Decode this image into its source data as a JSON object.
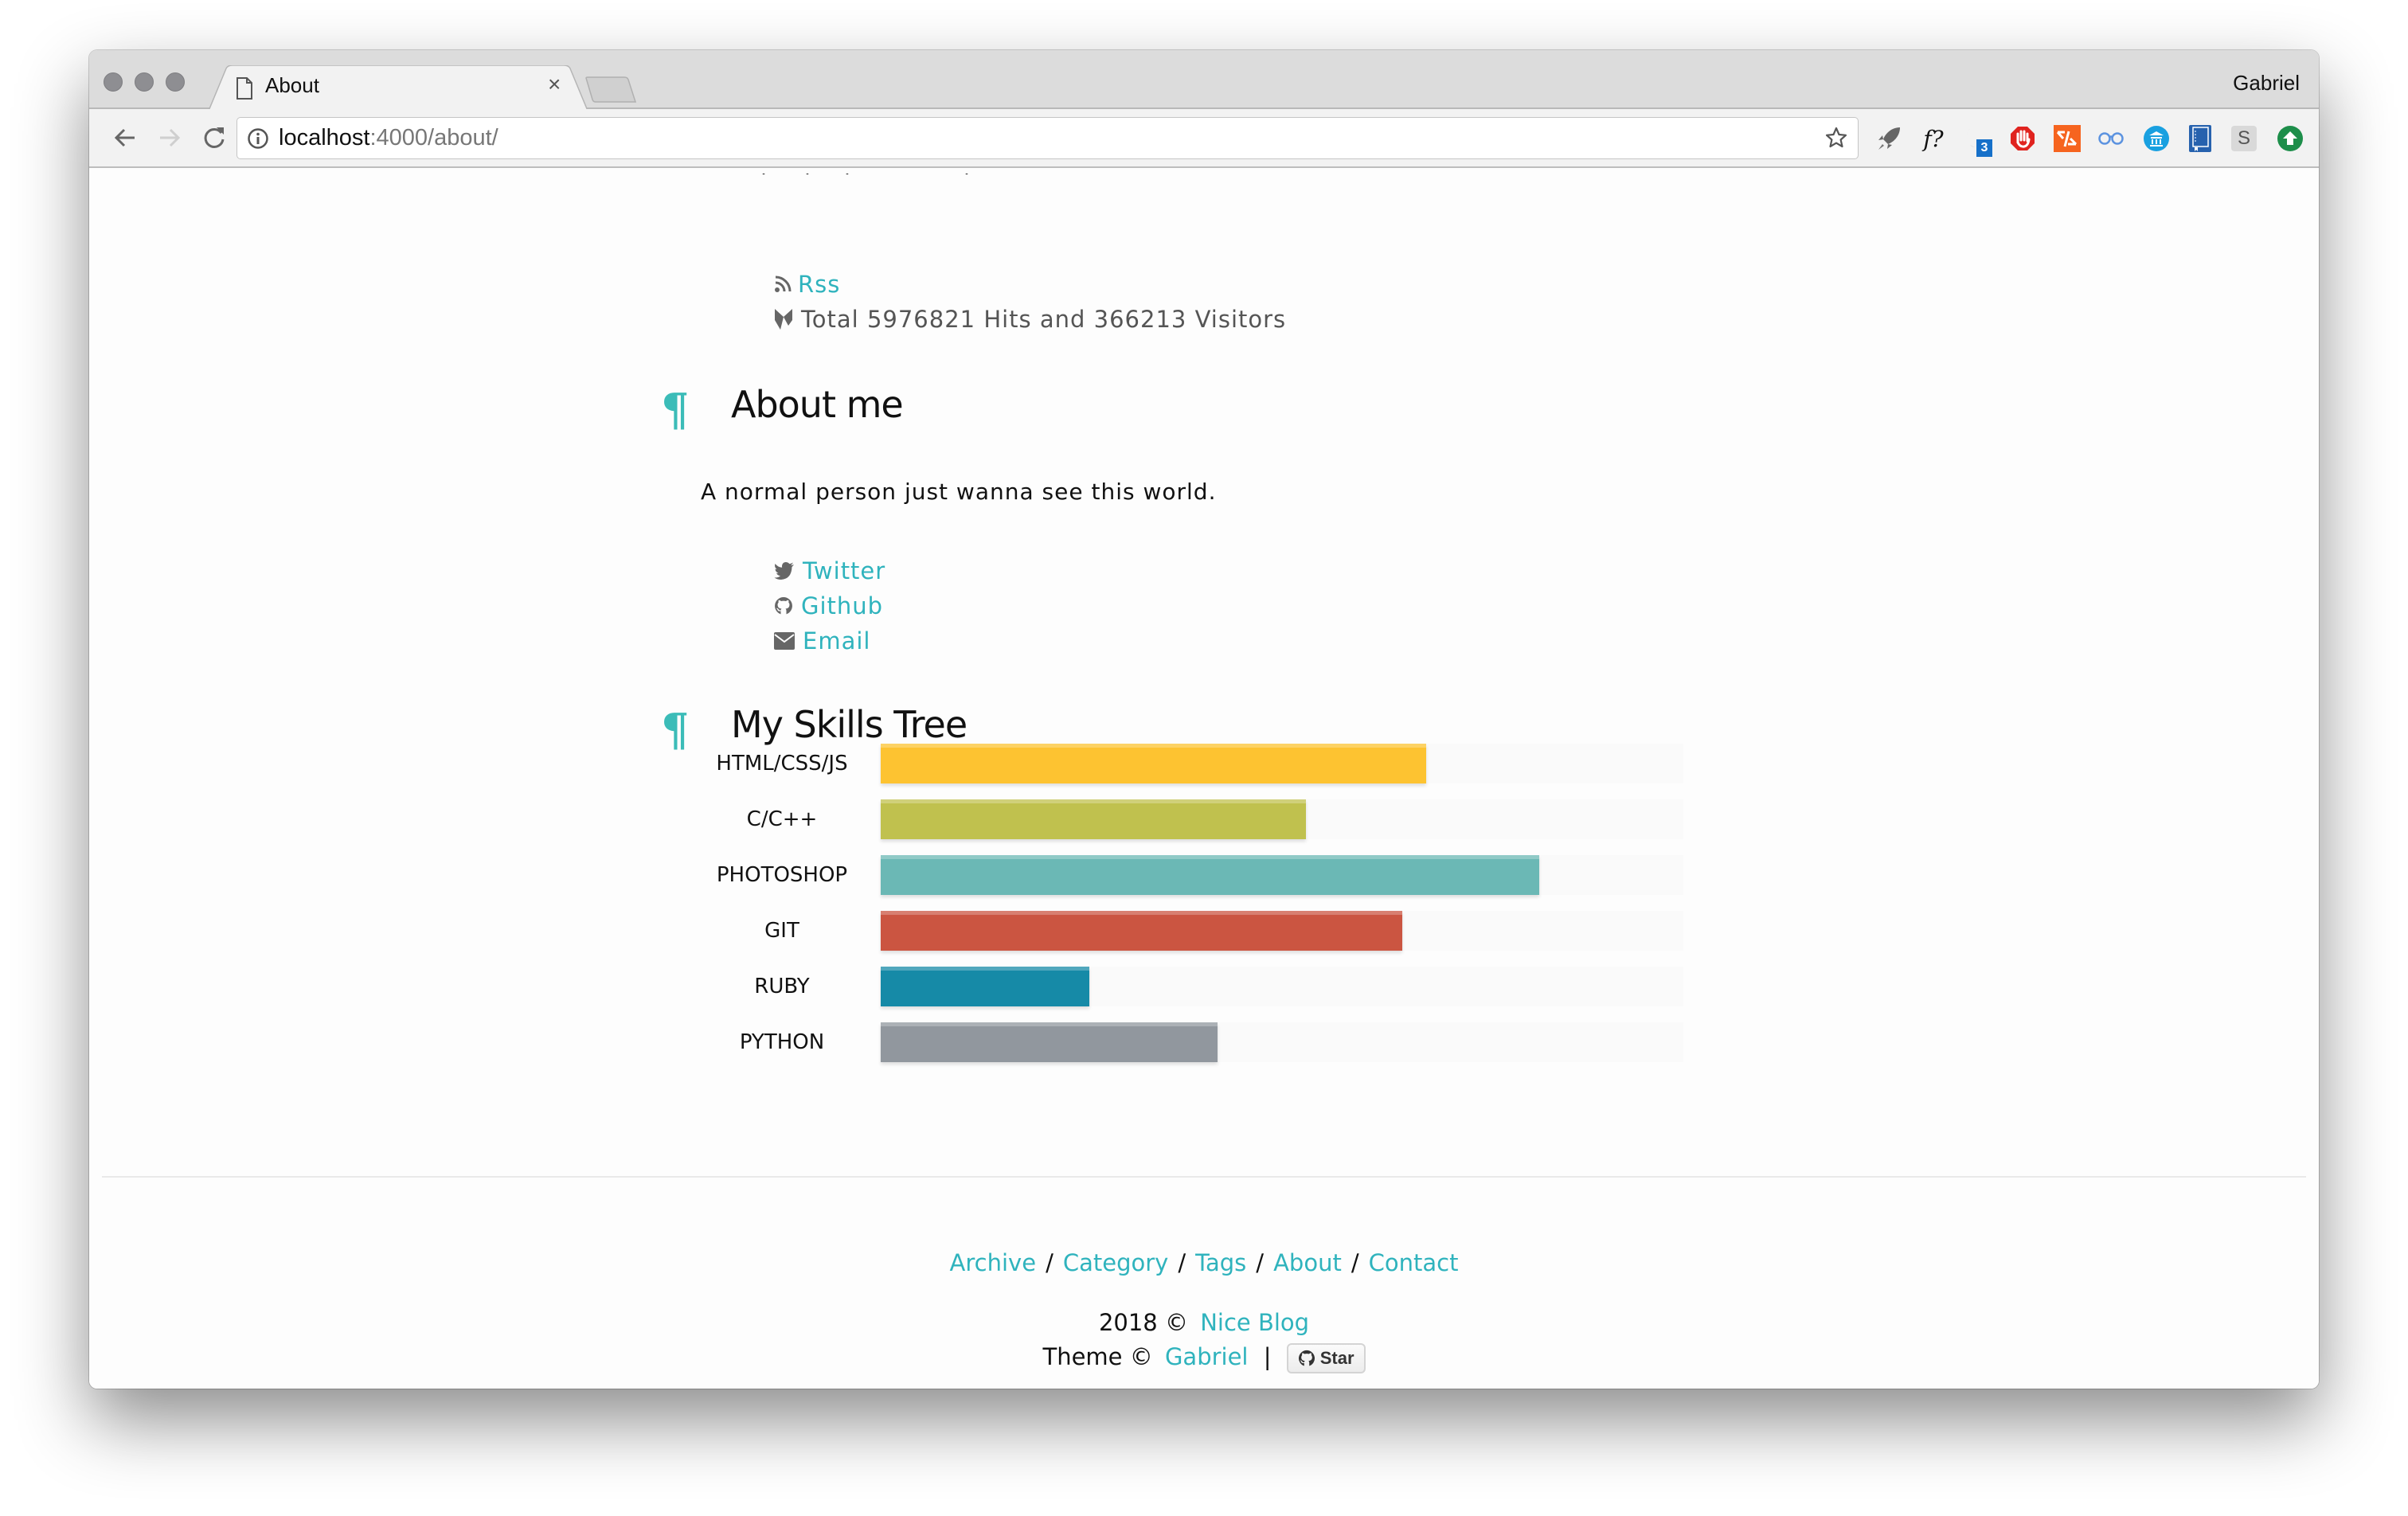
{
  "browser": {
    "tab_title": "About",
    "profile_name": "Gabriel",
    "url_host": "localhost",
    "url_rest": ":4000/about/",
    "extensions": [
      {
        "name": "rocket-extension-icon"
      },
      {
        "name": "formula-extension-icon",
        "label": "f?"
      },
      {
        "name": "moon-extension-icon",
        "badge": "3"
      },
      {
        "name": "adblock-extension-icon"
      },
      {
        "name": "code-extension-icon"
      },
      {
        "name": "glasses-extension-icon"
      },
      {
        "name": "bank-extension-icon"
      },
      {
        "name": "book-extension-icon"
      },
      {
        "name": "s-extension-icon",
        "label": "S"
      },
      {
        "name": "upload-extension-icon"
      }
    ]
  },
  "links_top": {
    "rss": "Rss",
    "stats": "Total 5976821 Hits and 366213 Visitors"
  },
  "about": {
    "heading": "About me",
    "pilcrow": "¶",
    "bio": "A normal person just wanna see this world.",
    "social": [
      {
        "label": "Twitter",
        "icon": "twitter-icon"
      },
      {
        "label": "Github",
        "icon": "github-icon"
      },
      {
        "label": "Email",
        "icon": "email-icon"
      }
    ]
  },
  "skills": {
    "heading": "My Skills Tree",
    "pilcrow": "¶"
  },
  "chart_data": {
    "type": "bar",
    "orientation": "horizontal",
    "title": "My Skills Tree",
    "categories": [
      "HTML/CSS/JS",
      "C/C++",
      "PHOTOSHOP",
      "GIT",
      "RUBY",
      "PYTHON"
    ],
    "values": [
      68,
      53,
      82,
      65,
      26,
      42
    ],
    "colors": [
      "#fdc331",
      "#c0c14e",
      "#6bb8b5",
      "#cb5541",
      "#168aa7",
      "#91979e"
    ],
    "xlim": [
      0,
      100
    ],
    "unit": "%",
    "grid": false,
    "legend": "none"
  },
  "footer": {
    "nav": [
      "Archive",
      "Category",
      "Tags",
      "About",
      "Contact"
    ],
    "separator": "/",
    "copyright_prefix": "2018 ©",
    "site_name": "Nice Blog",
    "theme_prefix": "Theme ©",
    "theme_author": "Gabriel",
    "pipe": "|",
    "star_label": "Star"
  },
  "colors": {
    "accent": "#2fb3bd",
    "pilcrow": "#3bbcb8"
  }
}
